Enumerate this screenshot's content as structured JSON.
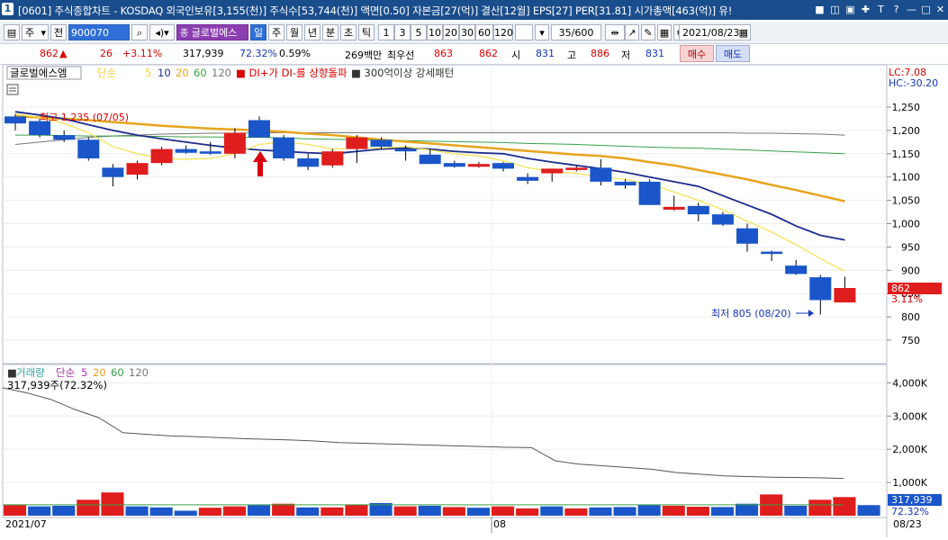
{
  "window": {
    "badge": "1",
    "title": "[0601] 주식종합차트 - KOSDAQ 외국인보유[3,155(천)] 주식수[53,744(천)] 액면[0.50] 자본금[27(억)] 결산[12월] EPS[27] PER[31.81] 시가총액[463(억)] 유!",
    "buttons": [
      "■",
      "◫",
      "▣",
      "✚",
      "T",
      "?",
      "—",
      "□",
      "✕"
    ]
  },
  "toolbar": {
    "period_select": "주",
    "total_label": "전",
    "code": "900070",
    "stock_name": "글로벌에스",
    "periods": [
      "일",
      "주",
      "월",
      "년",
      "분",
      "초",
      "틱"
    ],
    "active_period": "일",
    "intervals": [
      "1",
      "3",
      "5",
      "10",
      "20",
      "30",
      "60",
      "120"
    ],
    "count": "35",
    "count_max": "/600",
    "date": "2021/08/23"
  },
  "quote": {
    "price": "862",
    "arrow": "▲",
    "change": "26",
    "change_pct": "+3.11%",
    "volume": "317,939",
    "vol_ratio": "72.32%",
    "turnover": "0.59%",
    "amount": "269백만",
    "best_label": "최우선",
    "best_price": "863",
    "ask_price": "862",
    "open_label": "시",
    "open": "831",
    "high_label": "고",
    "high": "886",
    "low_label": "저",
    "low": "831",
    "buy_label": "매수",
    "sell_label": "매도"
  },
  "price_panel": {
    "legend": {
      "name": "글로벌에스엠",
      "ma_label": "단순",
      "ma_periods": [
        "5",
        "10",
        "20",
        "60",
        "120"
      ],
      "signal1": "DI+가 DI-를 상향돌파",
      "signal2": "300억이상 강세패턴"
    },
    "lc_label": "LC:7.08",
    "hc_label": "HC:-30.20",
    "high_annotation": "최고 1,235 (07/05)",
    "low_annotation": "최저 805 (08/20)",
    "last_price_tag": "862",
    "last_pct_tag": "3.11%",
    "y_ticks": [
      "1,250",
      "1,200",
      "1,150",
      "1,100",
      "1,050",
      "1,000",
      "950",
      "900",
      "850",
      "800",
      "750"
    ]
  },
  "volume_panel": {
    "legend": {
      "name": "거래량",
      "ma_label": "단순",
      "ma_periods": [
        "5",
        "20",
        "60",
        "120"
      ]
    },
    "current_label": "317,939주(72.32%)",
    "y_ticks": [
      "4,000K",
      "3,000K",
      "2,000K",
      "1,000K"
    ],
    "last_volume_tag": "317,939",
    "last_pct_tag": "72.32%"
  },
  "x_axis": {
    "labels": [
      "2021/07",
      "08"
    ],
    "right_label": "08/23"
  },
  "colors": {
    "up": "#e01d1d",
    "down": "#1a56c9",
    "ma5": "#f2e24a",
    "ma10": "#1d2c8c",
    "ma20": "#e8a41c",
    "ma60": "#3aa04a",
    "ma120": "#777777"
  },
  "chart_data": {
    "type": "candlestick",
    "candles": [
      {
        "o": 1230,
        "h": 1235,
        "l": 1200,
        "c": 1215
      },
      {
        "o": 1220,
        "h": 1225,
        "l": 1185,
        "c": 1190
      },
      {
        "o": 1190,
        "h": 1200,
        "l": 1175,
        "c": 1180
      },
      {
        "o": 1180,
        "h": 1185,
        "l": 1135,
        "c": 1140
      },
      {
        "o": 1120,
        "h": 1128,
        "l": 1080,
        "c": 1100
      },
      {
        "o": 1105,
        "h": 1135,
        "l": 1095,
        "c": 1130
      },
      {
        "o": 1130,
        "h": 1165,
        "l": 1125,
        "c": 1160
      },
      {
        "o": 1160,
        "h": 1168,
        "l": 1150,
        "c": 1152
      },
      {
        "o": 1155,
        "h": 1175,
        "l": 1148,
        "c": 1150
      },
      {
        "o": 1150,
        "h": 1205,
        "l": 1140,
        "c": 1195
      },
      {
        "o": 1222,
        "h": 1230,
        "l": 1185,
        "c": 1185
      },
      {
        "o": 1185,
        "h": 1190,
        "l": 1135,
        "c": 1140
      },
      {
        "o": 1140,
        "h": 1150,
        "l": 1115,
        "c": 1122
      },
      {
        "o": 1125,
        "h": 1160,
        "l": 1120,
        "c": 1155
      },
      {
        "o": 1160,
        "h": 1190,
        "l": 1130,
        "c": 1185
      },
      {
        "o": 1180,
        "h": 1185,
        "l": 1160,
        "c": 1165
      },
      {
        "o": 1160,
        "h": 1168,
        "l": 1135,
        "c": 1155
      },
      {
        "o": 1148,
        "h": 1160,
        "l": 1128,
        "c": 1128
      },
      {
        "o": 1130,
        "h": 1135,
        "l": 1120,
        "c": 1122
      },
      {
        "o": 1122,
        "h": 1132,
        "l": 1120,
        "c": 1128
      },
      {
        "o": 1130,
        "h": 1132,
        "l": 1112,
        "c": 1118
      },
      {
        "o": 1100,
        "h": 1108,
        "l": 1085,
        "c": 1092
      },
      {
        "o": 1108,
        "h": 1118,
        "l": 1090,
        "c": 1118
      },
      {
        "o": 1115,
        "h": 1125,
        "l": 1112,
        "c": 1120
      },
      {
        "o": 1120,
        "h": 1138,
        "l": 1082,
        "c": 1090
      },
      {
        "o": 1090,
        "h": 1095,
        "l": 1075,
        "c": 1082
      },
      {
        "o": 1090,
        "h": 1095,
        "l": 1040,
        "c": 1040
      },
      {
        "o": 1030,
        "h": 1060,
        "l": 1028,
        "c": 1036
      },
      {
        "o": 1038,
        "h": 1045,
        "l": 1005,
        "c": 1020
      },
      {
        "o": 1020,
        "h": 1025,
        "l": 995,
        "c": 998
      },
      {
        "o": 990,
        "h": 1000,
        "l": 940,
        "c": 957
      },
      {
        "o": 940,
        "h": 942,
        "l": 920,
        "c": 935
      },
      {
        "o": 910,
        "h": 922,
        "l": 890,
        "c": 892
      },
      {
        "o": 885,
        "h": 890,
        "l": 805,
        "c": 836
      },
      {
        "o": 831,
        "h": 886,
        "l": 831,
        "c": 862
      }
    ],
    "ma5": [
      1235,
      1228,
      1215,
      1195,
      1165,
      1150,
      1140,
      1138,
      1140,
      1150,
      1170,
      1175,
      1170,
      1160,
      1162,
      1162,
      1165,
      1158,
      1150,
      1145,
      1135,
      1120,
      1112,
      1108,
      1100,
      1095,
      1085,
      1068,
      1050,
      1030,
      1005,
      982,
      955,
      925,
      898
    ],
    "ma10": [
      1240,
      1233,
      1225,
      1212,
      1200,
      1190,
      1182,
      1175,
      1168,
      1162,
      1158,
      1155,
      1152,
      1150,
      1155,
      1160,
      1162,
      1160,
      1155,
      1152,
      1150,
      1140,
      1132,
      1125,
      1118,
      1110,
      1100,
      1090,
      1080,
      1060,
      1040,
      1020,
      995,
      975,
      965
    ],
    "ma20": [
      1230,
      1228,
      1225,
      1222,
      1218,
      1214,
      1210,
      1207,
      1204,
      1202,
      1200,
      1197,
      1193,
      1190,
      1185,
      1180,
      1176,
      1172,
      1168,
      1164,
      1160,
      1156,
      1152,
      1148,
      1145,
      1140,
      1132,
      1125,
      1115,
      1105,
      1095,
      1083,
      1072,
      1060,
      1048
    ],
    "ma60": [
      1190,
      1190,
      1189,
      1188,
      1188,
      1188,
      1187,
      1186,
      1186,
      1185,
      1185,
      1184,
      1182,
      1181,
      1180,
      1179,
      1178,
      1177,
      1176,
      1175,
      1174,
      1172,
      1171,
      1170,
      1168,
      1166,
      1164,
      1163,
      1162,
      1160,
      1158,
      1156,
      1154,
      1152,
      1150
    ],
    "ma120": [
      1170,
      1175,
      1180,
      1185,
      1188,
      1190,
      1192,
      1193,
      1194,
      1194,
      1195,
      1195,
      1195,
      1195,
      1195,
      1195,
      1195,
      1195,
      1195,
      1195,
      1195,
      1195,
      1195,
      1195,
      1195,
      1195,
      1195,
      1195,
      1195,
      1195,
      1194,
      1194,
      1193,
      1192,
      1190
    ],
    "volume": [
      320,
      280,
      300,
      480,
      700,
      280,
      250,
      150,
      240,
      280,
      320,
      360,
      250,
      250,
      330,
      380,
      280,
      300,
      260,
      240,
      280,
      220,
      280,
      220,
      250,
      260,
      320,
      300,
      270,
      260,
      360,
      640,
      300,
      480,
      560,
      318
    ],
    "volume_up_flags": [
      1,
      0,
      0,
      1,
      1,
      0,
      0,
      0,
      1,
      1,
      0,
      1,
      0,
      1,
      1,
      0,
      1,
      0,
      1,
      0,
      1,
      1,
      0,
      1,
      0,
      0,
      0,
      1,
      1,
      0,
      0,
      1,
      0,
      1,
      1,
      0
    ],
    "vol_ma_line": [
      3850,
      3700,
      3500,
      3200,
      2950,
      2500,
      2450,
      2400,
      2380,
      2350,
      2320,
      2300,
      2280,
      2250,
      2200,
      2180,
      2160,
      2140,
      2120,
      2100,
      2080,
      2060,
      2050,
      1650,
      1550,
      1500,
      1450,
      1400,
      1300,
      1250,
      1200,
      1180,
      1160,
      1150,
      1140,
      1120
    ],
    "y_range": [
      700,
      1275
    ],
    "volume_range": [
      0,
      4200
    ]
  }
}
